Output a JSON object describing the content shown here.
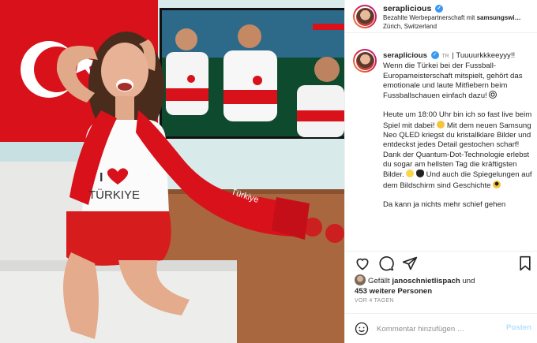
{
  "header": {
    "username": "seraplicious",
    "paid_prefix": "Bezahlte Werbepartnerschaft mit ",
    "paid_partner": "samsungswi…",
    "location": "Zürich, Switzerland"
  },
  "caption": {
    "username": "seraplicious",
    "lang": "TR",
    "line1": " | Tuuuurkkkeeyyy!! Wenn die Türkei bei der Fussball-Europameisterschaft mitspielt, gehört das emotionale und laute Mitfiebern beim Fussballschauen einfach dazu!",
    "para2a": "Heute um 18:00 Uhr bin ich so fast live beim Spiel mit dabei!",
    "para2b": " Mit dem neuen Samsung Neo QLED kriegst du kristallklare Bilder und entdeckst jedes Detail gestochen scharf! Dank der Quantum-Dot-Technologie erlebst du sogar am hellsten Tag die kräftigsten Bilder.",
    "para2c": " Und auch die Spiegelungen auf dem Bildschirm sind Geschichte",
    "para3": "Da kann ja nichts mehr schief gehen"
  },
  "likes": {
    "prefix": "Gefällt ",
    "user": "janoschnietlispach",
    "mid": " und",
    "others": "453 weitere Personen"
  },
  "time_ago": "VOR 4 TAGEN",
  "comment": {
    "placeholder": "Kommentar hinzufügen …",
    "post_label": "Posten"
  },
  "photo": {
    "shirt_text_top": "I",
    "shirt_text_bottom": "TÜRKIYE",
    "scarf_text": "Türkiye"
  },
  "colors": {
    "verified": "#3897f0",
    "turkey_red": "#e30a17",
    "post_disabled": "#b2dffc"
  }
}
